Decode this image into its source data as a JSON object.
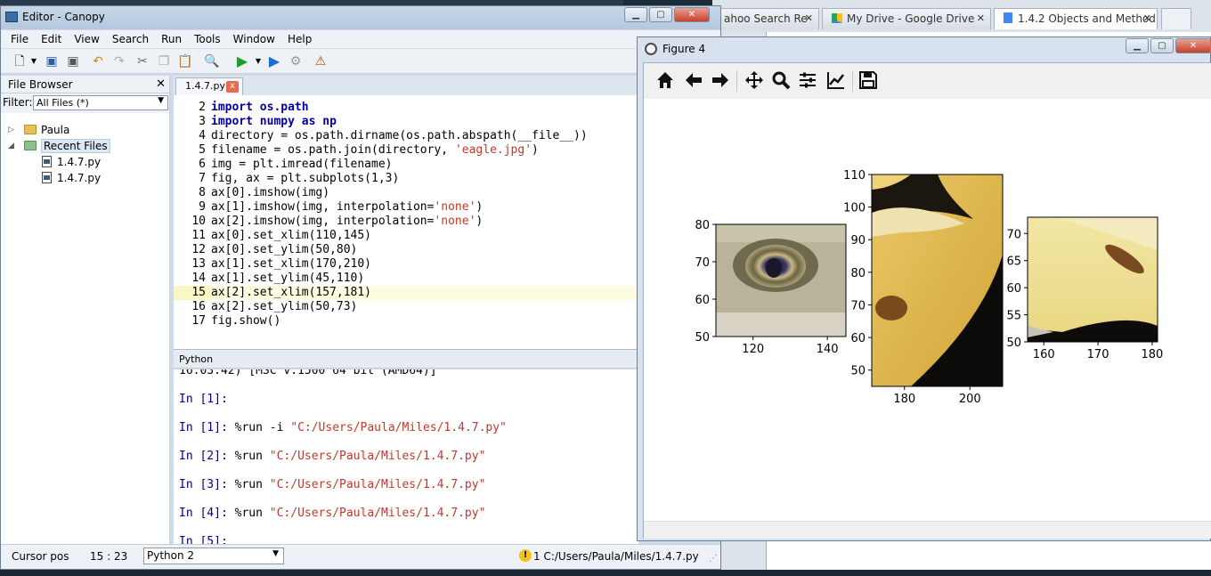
{
  "editor": {
    "title": "Editor - Canopy",
    "menu": [
      "File",
      "Edit",
      "View",
      "Search",
      "Run",
      "Tools",
      "Window",
      "Help"
    ]
  },
  "file_browser": {
    "title": "File Browser",
    "filter_label": "Filter:",
    "filter_value": "All Files (*)",
    "tree": [
      {
        "label": "Paula",
        "type": "folder",
        "expanded": false
      },
      {
        "label": "Recent Files",
        "type": "folder",
        "expanded": true,
        "children": [
          "1.4.7.py",
          "1.4.7.py"
        ]
      }
    ]
  },
  "code_tab": {
    "label": "1.4.7.py",
    "close": "x"
  },
  "code_lines": [
    {
      "n": "2",
      "text": "import os.path"
    },
    {
      "n": "3",
      "text": "import numpy as np"
    },
    {
      "n": "4",
      "text": "directory = os.path.dirname(os.path.abspath(__file__))"
    },
    {
      "n": "5",
      "text": "filename = os.path.join(directory, 'eagle.jpg')"
    },
    {
      "n": "6",
      "text": "img = plt.imread(filename)"
    },
    {
      "n": "7",
      "text": "fig, ax = plt.subplots(1,3)"
    },
    {
      "n": "8",
      "text": "ax[0].imshow(img)"
    },
    {
      "n": "9",
      "text": "ax[1].imshow(img, interpolation='none')"
    },
    {
      "n": "10",
      "text": "ax[2].imshow(img, interpolation='none')"
    },
    {
      "n": "11",
      "text": "ax[0].set_xlim(110,145)"
    },
    {
      "n": "12",
      "text": "ax[0].set_ylim(50,80)"
    },
    {
      "n": "13",
      "text": "ax[1].set_xlim(170,210)"
    },
    {
      "n": "14",
      "text": "ax[1].set_ylim(45,110)"
    },
    {
      "n": "15",
      "text": "ax[2].set_xlim(157,181)"
    },
    {
      "n": "16",
      "text": "ax[2].set_ylim(50,73)"
    },
    {
      "n": "17",
      "text": "fig.show()"
    }
  ],
  "python_panel": {
    "title": "Python",
    "lines": [
      {
        "prompt": "",
        "text": "16:03:42) [MSC v.1500 64 bit (AMD64)]"
      },
      {
        "prompt": "In [1]:",
        "text": ""
      },
      {
        "prompt": "In [1]:",
        "text": "%run -i \"C:/Users/Paula/Miles/1.4.7.py\""
      },
      {
        "prompt": "In [2]:",
        "text": "%run \"C:/Users/Paula/Miles/1.4.7.py\""
      },
      {
        "prompt": "In [3]:",
        "text": "%run \"C:/Users/Paula/Miles/1.4.7.py\""
      },
      {
        "prompt": "In [4]:",
        "text": "%run \"C:/Users/Paula/Miles/1.4.7.py\""
      },
      {
        "prompt": "In [5]:",
        "text": ""
      }
    ]
  },
  "status": {
    "cursor_label": "Cursor pos",
    "cursor_value": "15 : 23",
    "interpreter": "Python 2",
    "warning_count": "1",
    "path": "C:/Users/Paula/Miles/1.4.7.py"
  },
  "browser_tabs": [
    {
      "label": "ahoo Search Re",
      "icon": "yahoo"
    },
    {
      "label": "My Drive - Google Drive",
      "icon": "drive"
    },
    {
      "label": "1.4.2 Objects and Method",
      "icon": "doc"
    }
  ],
  "figure": {
    "title": "Figure 4",
    "toolbar": [
      "home-icon",
      "back-icon",
      "forward-icon",
      "pan-icon",
      "zoom-icon",
      "configure-icon",
      "edit-axes-icon",
      "save-icon"
    ]
  },
  "chart_data": [
    {
      "type": "image",
      "xlim": [
        110,
        145
      ],
      "ylim": [
        50,
        80
      ],
      "xticks": [
        "120",
        "140"
      ],
      "yticks": [
        "50",
        "60",
        "70",
        "80"
      ]
    },
    {
      "type": "image",
      "xlim": [
        170,
        210
      ],
      "ylim": [
        45,
        110
      ],
      "xticks": [
        "180",
        "200"
      ],
      "yticks": [
        "50",
        "60",
        "70",
        "80",
        "90",
        "100",
        "110"
      ]
    },
    {
      "type": "image",
      "xlim": [
        157,
        181
      ],
      "ylim": [
        50,
        73
      ],
      "xticks": [
        "160",
        "170",
        "180"
      ],
      "yticks": [
        "50",
        "55",
        "60",
        "65",
        "70"
      ]
    }
  ]
}
